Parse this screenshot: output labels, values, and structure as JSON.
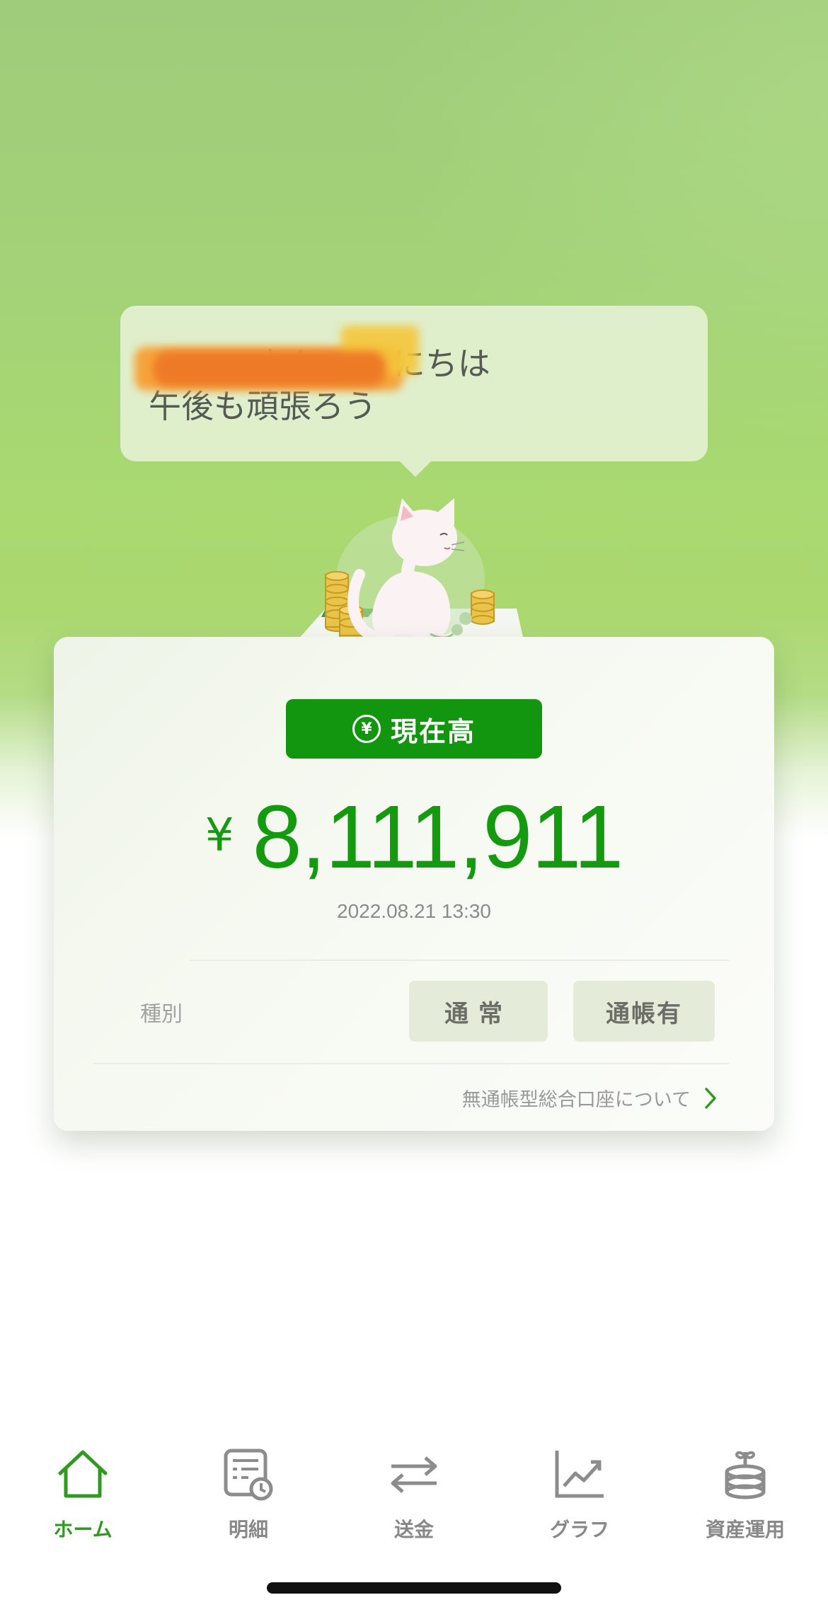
{
  "greeting": {
    "line1_suffix": "さん こんにちは",
    "line2": "午後も頑張ろう"
  },
  "balance": {
    "badge_label": "現在高",
    "badge_icon": "yen-circle-icon",
    "currency": "¥",
    "amount": "8,111,911",
    "timestamp": "2022.08.21 13:30"
  },
  "account": {
    "type_label": "種別",
    "type_chips": [
      "通常",
      "通帳有"
    ],
    "link_label": "無通帳型総合口座について"
  },
  "tabbar": {
    "items": [
      {
        "label": "ホーム",
        "icon": "home-icon",
        "active": true
      },
      {
        "label": "明細",
        "icon": "statement-icon",
        "active": false
      },
      {
        "label": "送金",
        "icon": "transfer-icon",
        "active": false
      },
      {
        "label": "グラフ",
        "icon": "chart-icon",
        "active": false
      },
      {
        "label": "資産運用",
        "icon": "coins-gift-icon",
        "active": false
      }
    ]
  },
  "colors": {
    "brand_green": "#12950f",
    "active_tab": "#2f9a1f",
    "inactive_tab": "#888888"
  }
}
